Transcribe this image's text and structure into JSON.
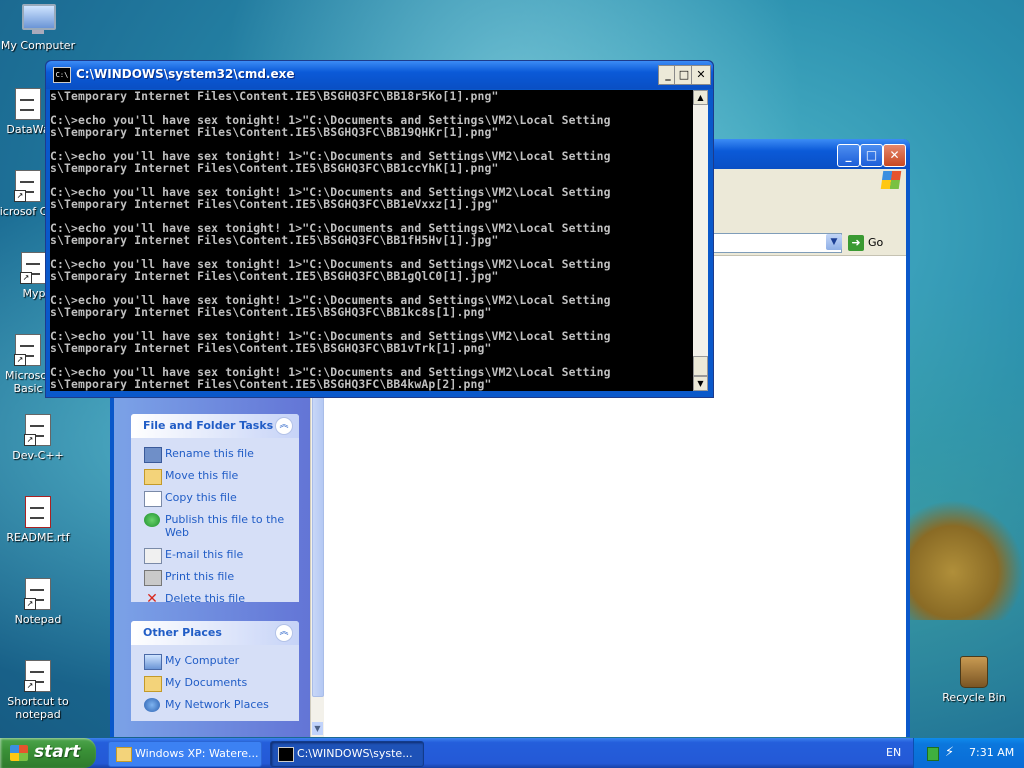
{
  "desktop": {
    "icons": [
      {
        "label": "My Computer",
        "icon": "my-computer-icon"
      },
      {
        "label": "DataWa",
        "icon": "datawa-shortcut-icon"
      },
      {
        "label": "Microsof C++",
        "icon": "microsoft-cpp-shortcut-icon"
      },
      {
        "label": "Myp",
        "icon": "myp-shortcut-icon"
      },
      {
        "label": "Microsof Basic",
        "icon": "microsoft-basic-shortcut-icon"
      },
      {
        "label": "Dev-C++",
        "icon": "dev-cpp-shortcut-icon"
      },
      {
        "label": "README.rtf",
        "icon": "rtf-document-icon"
      },
      {
        "label": "Notepad",
        "icon": "notepad-shortcut-icon"
      },
      {
        "label": "Shortcut to notepad",
        "icon": "notepad-shortcut-icon"
      },
      {
        "label": "Recycle Bin",
        "icon": "recycle-bin-icon"
      }
    ]
  },
  "explorer": {
    "address_go_label": "Go",
    "panels": {
      "file_tasks": {
        "title": "File and Folder Tasks",
        "items": [
          {
            "label": "Rename this file",
            "icon": "rename-icon"
          },
          {
            "label": "Move this file",
            "icon": "move-icon"
          },
          {
            "label": "Copy this file",
            "icon": "copy-icon"
          },
          {
            "label": "Publish this file to the Web",
            "icon": "publish-web-icon"
          },
          {
            "label": "E-mail this file",
            "icon": "email-icon"
          },
          {
            "label": "Print this file",
            "icon": "print-icon"
          },
          {
            "label": "Delete this file",
            "icon": "delete-icon"
          }
        ]
      },
      "other_places": {
        "title": "Other Places",
        "items": [
          {
            "label": "My Computer",
            "icon": "my-computer-icon"
          },
          {
            "label": "My Documents",
            "icon": "my-documents-icon"
          },
          {
            "label": "My Network Places",
            "icon": "my-network-places-icon"
          }
        ]
      }
    }
  },
  "cmd": {
    "title": "C:\\WINDOWS\\system32\\cmd.exe",
    "icon_text": "C:\\",
    "lines": [
      "s\\Temporary Internet Files\\Content.IE5\\BSGHQ3FC\\BB18r5Ko[1].png\"",
      "",
      "C:\\>echo you'll have sex tonight! 1>\"C:\\Documents and Settings\\VM2\\Local Setting",
      "s\\Temporary Internet Files\\Content.IE5\\BSGHQ3FC\\BB19QHKr[1].png\"",
      "",
      "C:\\>echo you'll have sex tonight! 1>\"C:\\Documents and Settings\\VM2\\Local Setting",
      "s\\Temporary Internet Files\\Content.IE5\\BSGHQ3FC\\BB1ccYhK[1].png\"",
      "",
      "C:\\>echo you'll have sex tonight! 1>\"C:\\Documents and Settings\\VM2\\Local Setting",
      "s\\Temporary Internet Files\\Content.IE5\\BSGHQ3FC\\BB1eVxxz[1].jpg\"",
      "",
      "C:\\>echo you'll have sex tonight! 1>\"C:\\Documents and Settings\\VM2\\Local Setting",
      "s\\Temporary Internet Files\\Content.IE5\\BSGHQ3FC\\BB1fH5Hv[1].jpg\"",
      "",
      "C:\\>echo you'll have sex tonight! 1>\"C:\\Documents and Settings\\VM2\\Local Setting",
      "s\\Temporary Internet Files\\Content.IE5\\BSGHQ3FC\\BB1gQlC0[1].jpg\"",
      "",
      "C:\\>echo you'll have sex tonight! 1>\"C:\\Documents and Settings\\VM2\\Local Setting",
      "s\\Temporary Internet Files\\Content.IE5\\BSGHQ3FC\\BB1kc8s[1].png\"",
      "",
      "C:\\>echo you'll have sex tonight! 1>\"C:\\Documents and Settings\\VM2\\Local Setting",
      "s\\Temporary Internet Files\\Content.IE5\\BSGHQ3FC\\BB1vTrk[1].png\"",
      "",
      "C:\\>echo you'll have sex tonight! 1>\"C:\\Documents and Settings\\VM2\\Local Setting",
      "s\\Temporary Internet Files\\Content.IE5\\BSGHQ3FC\\BB4kwAp[2].png\""
    ]
  },
  "taskbar": {
    "start_label": "start",
    "buttons": [
      {
        "label": "Windows XP: Watere...",
        "icon": "folder-window-icon",
        "active": false
      },
      {
        "label": "C:\\WINDOWS\\syste...",
        "icon": "cmd-icon",
        "active": true
      }
    ],
    "language": "EN",
    "clock": "7:31 AM"
  },
  "colors": {
    "xp_blue": "#0a58ca",
    "task_link": "#215dc6",
    "start_green": "#3a9137",
    "console_text": "#c0c0c0"
  }
}
